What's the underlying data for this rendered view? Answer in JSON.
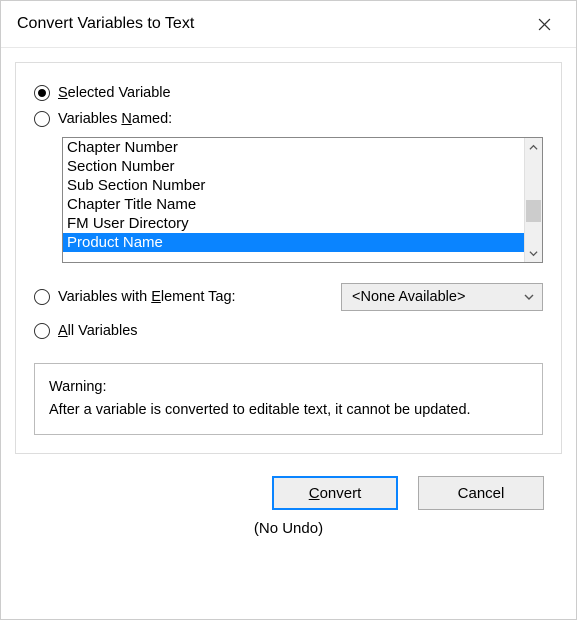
{
  "dialog": {
    "title": "Convert Variables to Text"
  },
  "options": {
    "selected_variable": {
      "label_before": "",
      "accel": "S",
      "label_after": "elected Variable",
      "checked": true
    },
    "variables_named": {
      "label_before": "Variables ",
      "accel": "N",
      "label_after": "amed:",
      "checked": false
    },
    "element_tag": {
      "label_before": "Variables with ",
      "accel": "E",
      "label_after": "lement Tag:",
      "checked": false
    },
    "all_variables": {
      "label_before": "",
      "accel": "A",
      "label_after": "ll Variables",
      "checked": false
    }
  },
  "listbox": {
    "items": [
      {
        "label": "Chapter Number",
        "selected": false
      },
      {
        "label": "Section Number",
        "selected": false
      },
      {
        "label": "Sub Section Number",
        "selected": false
      },
      {
        "label": "Chapter Title Name",
        "selected": false
      },
      {
        "label": "FM User Directory",
        "selected": false
      },
      {
        "label": "Product Name",
        "selected": true
      }
    ]
  },
  "element_combo": {
    "selected": "<None Available>"
  },
  "warning": {
    "title": "Warning:",
    "body": "After a variable is converted to editable text, it cannot be updated."
  },
  "buttons": {
    "convert_accel": "C",
    "convert_after": "onvert",
    "cancel": "Cancel"
  },
  "footer": {
    "no_undo": "(No Undo)"
  }
}
